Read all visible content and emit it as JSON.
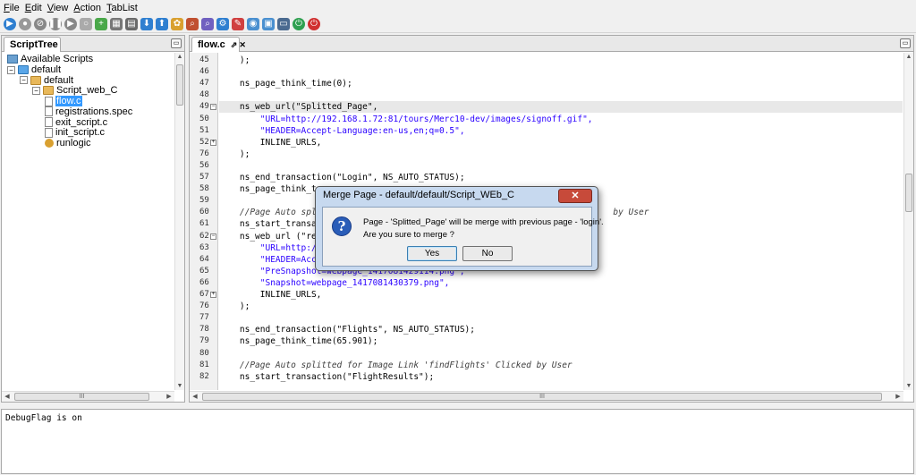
{
  "menu": [
    "File",
    "Edit",
    "View",
    "Action",
    "TabList"
  ],
  "toolbar_icons": [
    {
      "name": "run-icon",
      "color": "#2f7fd0",
      "glyph": "▶"
    },
    {
      "name": "record-icon",
      "color": "#999999",
      "glyph": "●"
    },
    {
      "name": "cancel-icon",
      "color": "#888888",
      "glyph": "⊘"
    },
    {
      "name": "pause-icon",
      "color": "#888888",
      "glyph": "❚❚"
    },
    {
      "name": "step-icon",
      "color": "#888888",
      "glyph": "▶"
    },
    {
      "name": "comment-icon",
      "color": "#aaaaaa",
      "glyph": "○"
    },
    {
      "name": "add-icon",
      "color": "#4aa84a",
      "glyph": "+"
    },
    {
      "name": "grid-icon",
      "color": "#777777",
      "glyph": "▦"
    },
    {
      "name": "export-icon",
      "color": "#6a6a6a",
      "glyph": "▤"
    },
    {
      "name": "down-arrow-icon",
      "color": "#2f7fd0",
      "glyph": "⬇"
    },
    {
      "name": "up-arrow-icon",
      "color": "#2f7fd0",
      "glyph": "⬆"
    },
    {
      "name": "settings-icon",
      "color": "#d9a030",
      "glyph": "✿"
    },
    {
      "name": "find-icon",
      "color": "#c05030",
      "glyph": "⌕"
    },
    {
      "name": "replace-icon",
      "color": "#7060c0",
      "glyph": "⌕"
    },
    {
      "name": "options-icon",
      "color": "#2f7fd0",
      "glyph": "⚙"
    },
    {
      "name": "edit-icon",
      "color": "#d04040",
      "glyph": "✎"
    },
    {
      "name": "web-icon",
      "color": "#4a90d0",
      "glyph": "◉"
    },
    {
      "name": "calendar-icon",
      "color": "#4a90d0",
      "glyph": "▣"
    },
    {
      "name": "monitor-icon",
      "color": "#4a6a90",
      "glyph": "▭"
    },
    {
      "name": "start-icon",
      "color": "#2fa050",
      "glyph": "⏻"
    },
    {
      "name": "stop-icon",
      "color": "#d03030",
      "glyph": "⏻"
    }
  ],
  "left_panel": {
    "tab": "ScriptTree",
    "root": "Available Scripts",
    "tree": [
      {
        "label": "default",
        "level": 1,
        "expander": "−",
        "icon": "folderblue"
      },
      {
        "label": "default",
        "level": 2,
        "expander": "−",
        "icon": "folder"
      },
      {
        "label": "Script_web_C",
        "level": 3,
        "expander": "−",
        "icon": "folder"
      },
      {
        "label": "flow.c",
        "level": 4,
        "expander": "",
        "icon": "file",
        "selected": true
      },
      {
        "label": "registrations.spec",
        "level": 4,
        "expander": "",
        "icon": "file"
      },
      {
        "label": "exit_script.c",
        "level": 4,
        "expander": "",
        "icon": "file"
      },
      {
        "label": "init_script.c",
        "level": 4,
        "expander": "",
        "icon": "file"
      },
      {
        "label": "runlogic",
        "level": 4,
        "expander": "",
        "icon": "gear"
      }
    ],
    "hscroll_label": "III"
  },
  "editor": {
    "tab": "flow.c",
    "tab_pin": "⇗",
    "tab_close": "✕",
    "hscroll_label": "III",
    "lines": [
      {
        "n": "45",
        "fold": "",
        "text": "    );",
        "cls": ""
      },
      {
        "n": "46",
        "fold": "",
        "text": "",
        "cls": ""
      },
      {
        "n": "47",
        "fold": "",
        "text": "    ns_page_think_time(0);",
        "cls": ""
      },
      {
        "n": "48",
        "fold": "",
        "text": "",
        "cls": ""
      },
      {
        "n": "49",
        "fold": "−",
        "text": "    ns_web_url(\"Splitted_Page\",",
        "cls": "hl"
      },
      {
        "n": "50",
        "fold": "",
        "text": "        \"URL=http://192.168.1.72:81/tours/Merc10-dev/images/signoff.gif\",",
        "cls": "s"
      },
      {
        "n": "51",
        "fold": "",
        "text": "        \"HEADER=Accept-Language:en-us,en;q=0.5\",",
        "cls": "s"
      },
      {
        "n": "52",
        "fold": "+",
        "text": "        INLINE_URLS,",
        "cls": ""
      },
      {
        "n": "76",
        "fold": "",
        "text": "    );",
        "cls": ""
      },
      {
        "n": "56",
        "fold": "",
        "text": "",
        "cls": ""
      },
      {
        "n": "57",
        "fold": "",
        "text": "    ns_end_transaction(\"Login\", NS_AUTO_STATUS);",
        "cls": "m"
      },
      {
        "n": "58",
        "fold": "",
        "text": "    ns_page_think_t",
        "cls": ""
      },
      {
        "n": "59",
        "fold": "",
        "text": "",
        "cls": ""
      },
      {
        "n": "60",
        "fold": "",
        "text": "    //Page Auto spli                                                         by User",
        "cls": "c"
      },
      {
        "n": "61",
        "fold": "",
        "text": "    ns_start_transa",
        "cls": ""
      },
      {
        "n": "62",
        "fold": "−",
        "text": "    ns_web_url (\"re",
        "cls": "m"
      },
      {
        "n": "63",
        "fold": "",
        "text": "        \"URL=http:/",
        "cls": "s"
      },
      {
        "n": "64",
        "fold": "",
        "text": "        \"HEADER=Acc",
        "cls": "s"
      },
      {
        "n": "65",
        "fold": "",
        "text": "        \"PreSnapshot=webpage_1417081429114.png\",",
        "cls": "s"
      },
      {
        "n": "66",
        "fold": "",
        "text": "        \"Snapshot=webpage_1417081430379.png\",",
        "cls": "s"
      },
      {
        "n": "67",
        "fold": "+",
        "text": "        INLINE_URLS,",
        "cls": ""
      },
      {
        "n": "76",
        "fold": "",
        "text": "    );",
        "cls": ""
      },
      {
        "n": "77",
        "fold": "",
        "text": "",
        "cls": ""
      },
      {
        "n": "78",
        "fold": "",
        "text": "    ns_end_transaction(\"Flights\", NS_AUTO_STATUS);",
        "cls": "m"
      },
      {
        "n": "79",
        "fold": "",
        "text": "    ns_page_think_time(65.901);",
        "cls": ""
      },
      {
        "n": "80",
        "fold": "",
        "text": "",
        "cls": ""
      },
      {
        "n": "81",
        "fold": "",
        "text": "    //Page Auto splitted for Image Link 'findFlights' Clicked by User",
        "cls": "c"
      },
      {
        "n": "82",
        "fold": "",
        "text": "    ns_start_transaction(\"FlightResults\");",
        "cls": "m"
      }
    ]
  },
  "debug": {
    "text": "DebugFlag is on"
  },
  "dialog": {
    "title": "Merge Page - default/default/Script_WEb_C",
    "close": "✕",
    "icon": "?",
    "message_line1": "Page - 'Splitted_Page' will be merge with previous page - 'login'.",
    "message_line2": "Are you sure to merge ?",
    "yes": "Yes",
    "no": "No"
  }
}
